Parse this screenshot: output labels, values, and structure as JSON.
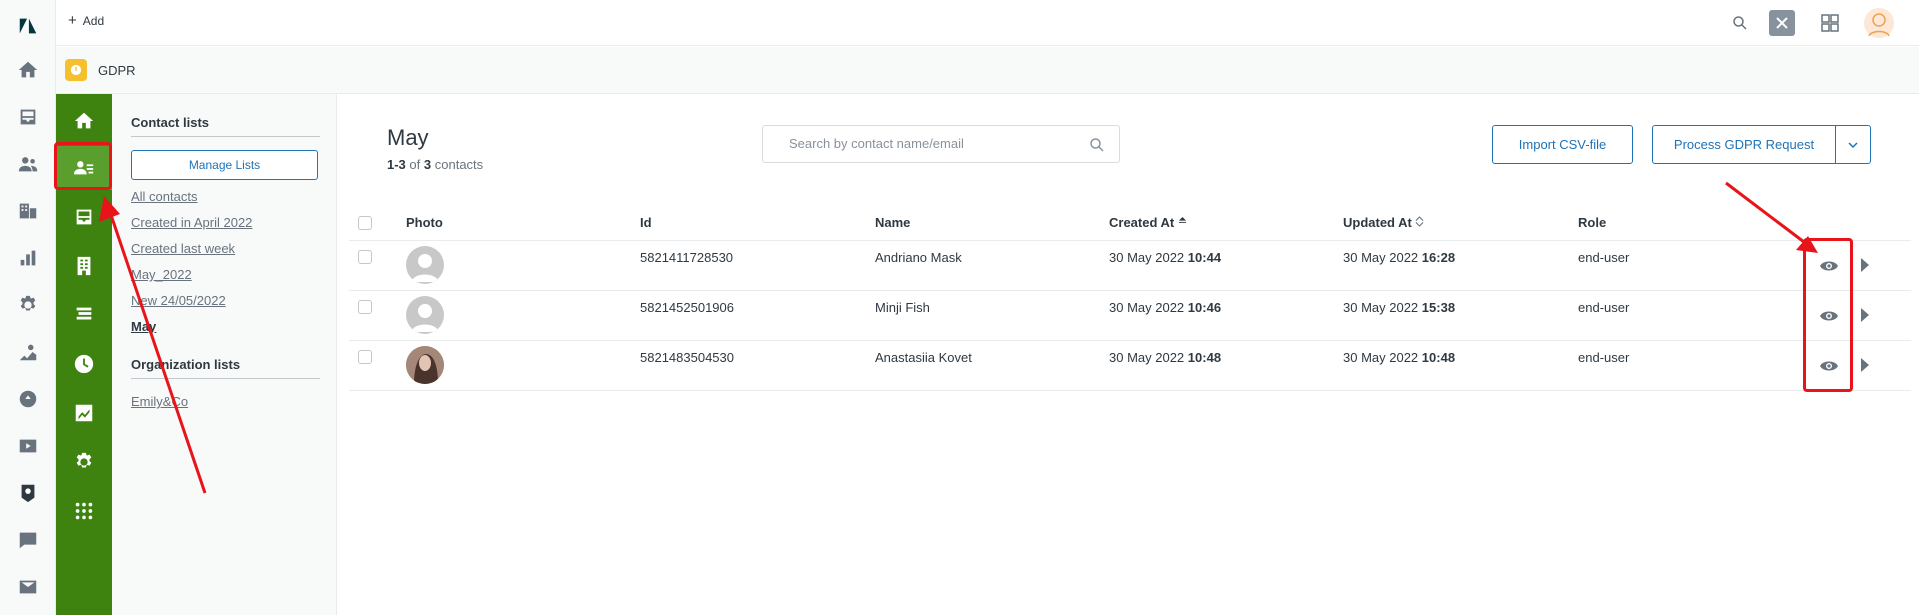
{
  "topbar": {
    "add_label": "Add"
  },
  "app": {
    "title": "GDPR"
  },
  "subnav": {
    "contact_lists_title": "Contact lists",
    "manage_button": "Manage Lists",
    "contact_lists": [
      "All contacts",
      "Created in April 2022",
      "Created last week",
      "May_2022",
      "New 24/05/2022",
      "May"
    ],
    "current_list": "May",
    "organization_lists_title": "Organization lists",
    "organization_lists": [
      "Emily&Co"
    ]
  },
  "main": {
    "heading": "May",
    "count_range": "1-3",
    "count_of": "of",
    "count_total": "3",
    "count_suffix": "contacts",
    "search_placeholder": "Search by contact name/email",
    "import_button": "Import CSV-file",
    "process_button": "Process GDPR Request"
  },
  "table": {
    "headers": {
      "photo": "Photo",
      "id": "Id",
      "name": "Name",
      "created": "Created At",
      "updated": "Updated At",
      "role": "Role"
    },
    "rows": [
      {
        "id": "5821411728530",
        "name": "Andriano Mask",
        "created_date": "30 May 2022",
        "created_time": "10:44",
        "updated_date": "30 May 2022",
        "updated_time": "16:28",
        "role": "end-user",
        "avatar": "default"
      },
      {
        "id": "5821452501906",
        "name": "Minji Fish",
        "created_date": "30 May 2022",
        "created_time": "10:46",
        "updated_date": "30 May 2022",
        "updated_time": "15:38",
        "role": "end-user",
        "avatar": "default"
      },
      {
        "id": "5821483504530",
        "name": "Anastasiia Kovet",
        "created_date": "30 May 2022",
        "created_time": "10:48",
        "updated_date": "30 May 2022",
        "updated_time": "10:48",
        "role": "end-user",
        "avatar": "photo"
      }
    ]
  },
  "colors": {
    "nav_green": "#3e8310",
    "accent_blue": "#1f73b7",
    "annotation_red": "#e8141a"
  }
}
